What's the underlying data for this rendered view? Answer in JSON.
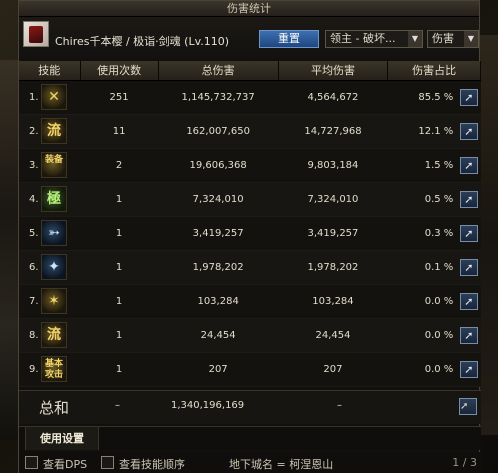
{
  "window": {
    "title": "伤害统计"
  },
  "header": {
    "character": "Chires千本樱 / 极诣·剑魂 (Lv.110)",
    "reset_label": "重置",
    "dungeon_select": "领主 - 破坏...",
    "stat_select": "伤害"
  },
  "table": {
    "columns": [
      "技能",
      "使用次数",
      "总伤害",
      "平均伤害",
      "伤害占比"
    ],
    "rows": [
      {
        "idx": "1.",
        "icon": "slash-skill-icon",
        "glyph": "✕",
        "uses": "251",
        "total": "1,145,732,737",
        "avg": "4,564,672",
        "pct": "85.5 %"
      },
      {
        "idx": "2.",
        "icon": "flow-crescent-icon",
        "glyph": "流",
        "uses": "11",
        "total": "162,007,650",
        "avg": "14,727,968",
        "pct": "12.1 %"
      },
      {
        "idx": "3.",
        "icon": "equipment-icon",
        "glyph": "装备",
        "uses": "2",
        "total": "19,606,368",
        "avg": "9,803,184",
        "pct": "1.5 %"
      },
      {
        "idx": "4.",
        "icon": "green-rune-icon",
        "glyph": "極",
        "uses": "1",
        "total": "7,324,010",
        "avg": "7,324,010",
        "pct": "0.5 %"
      },
      {
        "idx": "5.",
        "icon": "arrow-thrust-icon",
        "glyph": "➳",
        "uses": "1",
        "total": "3,419,257",
        "avg": "3,419,257",
        "pct": "0.3 %"
      },
      {
        "idx": "6.",
        "icon": "beast-summon-icon",
        "glyph": "✦",
        "uses": "1",
        "total": "1,978,202",
        "avg": "1,978,202",
        "pct": "0.1 %"
      },
      {
        "idx": "7.",
        "icon": "sword-burst-icon",
        "glyph": "✶",
        "uses": "1",
        "total": "103,284",
        "avg": "103,284",
        "pct": "0.0 %"
      },
      {
        "idx": "8.",
        "icon": "flow-script-icon",
        "glyph": "流",
        "uses": "1",
        "total": "24,454",
        "avg": "24,454",
        "pct": "0.0 %"
      },
      {
        "idx": "9.",
        "icon": "basic-attack-icon",
        "glyph": "基本攻击",
        "uses": "1",
        "total": "207",
        "avg": "207",
        "pct": "0.0 %"
      }
    ]
  },
  "total": {
    "label": "总和",
    "uses": "–",
    "total": "1,340,196,169",
    "avg": "–"
  },
  "tabs": {
    "settings": "使用设置"
  },
  "footer": {
    "show_dps": "查看DPS",
    "show_skill_order": "查看技能顺序",
    "dungeon_name": "地下城名 = 柯涅恩山",
    "page": "1 / 3"
  }
}
